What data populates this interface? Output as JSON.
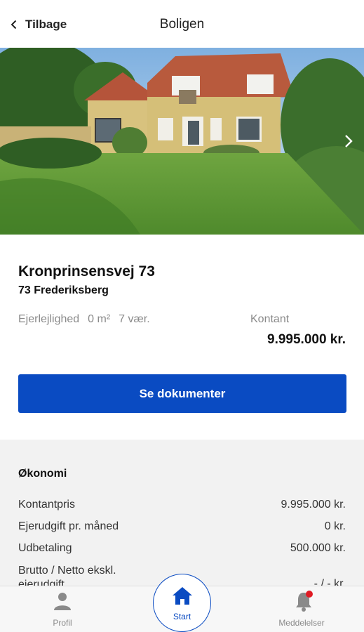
{
  "header": {
    "back_label": "Tilbage",
    "title": "Boligen"
  },
  "property": {
    "address": "Kronprinsensvej 73",
    "city": "73 Frederiksberg",
    "type": "Ejerlejlighed",
    "area": "0 m²",
    "rooms": "7 vær.",
    "price_label": "Kontant",
    "price_value": "9.995.000 kr.",
    "documents_button": "Se dokumenter"
  },
  "economy": {
    "title": "Økonomi",
    "rows": [
      {
        "label": "Kontantpris",
        "value": "9.995.000 kr."
      },
      {
        "label": "Ejerudgift pr. måned",
        "value": "0 kr."
      },
      {
        "label": "Udbetaling",
        "value": "500.000 kr."
      },
      {
        "label": "Brutto / Netto ekskl. ejerudgift",
        "value": "- / - kr."
      }
    ]
  },
  "tabbar": {
    "profil": "Profil",
    "start": "Start",
    "meddelelser": "Meddelelser"
  },
  "colors": {
    "accent": "#0a4bc2",
    "notification": "#e01b24"
  }
}
